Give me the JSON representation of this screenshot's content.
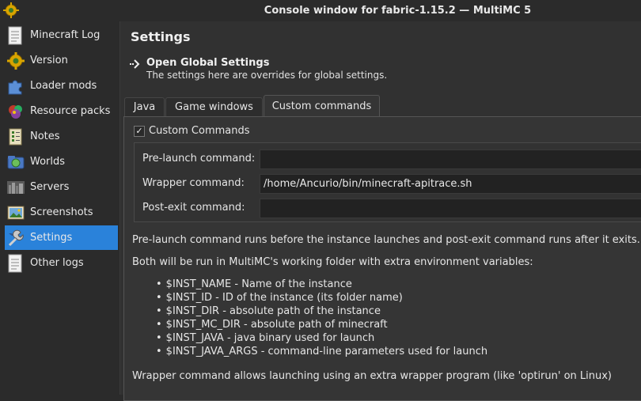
{
  "window": {
    "title": "Console window for fabric-1.15.2 — MultiMC 5"
  },
  "sidebar": {
    "items": [
      {
        "label": "Minecraft Log",
        "icon": "log-icon",
        "selected": false
      },
      {
        "label": "Version",
        "icon": "version-gear-icon",
        "selected": false
      },
      {
        "label": "Loader mods",
        "icon": "puzzle-icon",
        "selected": false
      },
      {
        "label": "Resource packs",
        "icon": "resource-packs-icon",
        "selected": false
      },
      {
        "label": "Notes",
        "icon": "notes-icon",
        "selected": false
      },
      {
        "label": "Worlds",
        "icon": "worlds-icon",
        "selected": false
      },
      {
        "label": "Servers",
        "icon": "servers-icon",
        "selected": false
      },
      {
        "label": "Screenshots",
        "icon": "screenshots-icon",
        "selected": false
      },
      {
        "label": "Settings",
        "icon": "settings-icon",
        "selected": true
      },
      {
        "label": "Other logs",
        "icon": "log-icon",
        "selected": false
      }
    ]
  },
  "main": {
    "title": "Settings",
    "global_settings": {
      "title": "Open Global Settings",
      "subtitle": "The settings here are overrides for global settings."
    },
    "tabs": [
      {
        "label": "Java",
        "active": false
      },
      {
        "label": "Game windows",
        "active": false
      },
      {
        "label": "Custom commands",
        "active": true
      }
    ],
    "custom_commands": {
      "checkbox_label": "Custom Commands",
      "checked": true,
      "fields": {
        "pre_launch": {
          "label": "Pre-launch command:",
          "value": ""
        },
        "wrapper": {
          "label": "Wrapper command:",
          "value": "/home/Ancurio/bin/minecraft-apitrace.sh"
        },
        "post_exit": {
          "label": "Post-exit command:",
          "value": ""
        }
      },
      "info_1": "Pre-launch command runs before the instance launches and post-exit command runs after it exits.",
      "info_2": "Both will be run in MultiMC's working folder with extra environment variables:",
      "variables": [
        "$INST_NAME - Name of the instance",
        "$INST_ID - ID of the instance (its folder name)",
        "$INST_DIR - absolute path of the instance",
        "$INST_MC_DIR - absolute path of minecraft",
        "$INST_JAVA - java binary used for launch",
        "$INST_JAVA_ARGS - command-line parameters used for launch"
      ],
      "info_3": "Wrapper command allows launching using an extra wrapper program (like 'optirun' on Linux)"
    }
  },
  "colors": {
    "accent": "#2a82da",
    "background": "#313131",
    "panel": "#353535"
  }
}
